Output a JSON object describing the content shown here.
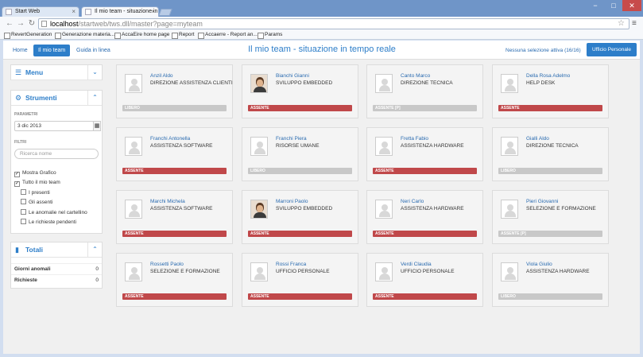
{
  "browser": {
    "tabs": [
      {
        "label": "Start Web",
        "active": false
      },
      {
        "label": "Il mio team - situazione in",
        "active": true
      }
    ],
    "url_host": "localhost",
    "url_path": "/startweb/tws.dll/master?page=myteam",
    "bookmarks": [
      "RevertGeneration",
      "Generazione materia...",
      "AccaEire home page",
      "Report",
      "Accaerre - Report an...",
      "Params"
    ],
    "window_controls": [
      "−",
      "□",
      "✕"
    ]
  },
  "topnav": {
    "links": [
      "Home",
      "Il mio team",
      "Guida in linea"
    ],
    "active_link": "Il mio team",
    "title": "Il mio team - situazione in tempo reale",
    "selection_status": "Nessuna selezione attiva (16/16)",
    "office_button": "Ufficio Personale"
  },
  "sidebar": {
    "menu": {
      "title": "Menu",
      "toggle": "⌄"
    },
    "tools": {
      "title": "Strumenti",
      "toggle": "⌃",
      "params_label": "PARAMETRI",
      "date_value": "3 dic 2013",
      "filters_label": "FILTRI",
      "search_placeholder": "Ricerca nome",
      "checks": [
        {
          "label": "Mostra Grafico",
          "checked": true,
          "indent": 0
        },
        {
          "label": "Tutto il mio team",
          "checked": true,
          "indent": 0
        },
        {
          "label": "I presenti",
          "checked": false,
          "indent": 1
        },
        {
          "label": "Gli assenti",
          "checked": false,
          "indent": 1
        },
        {
          "label": "Le anomalie nel cartellino",
          "checked": false,
          "indent": 1
        },
        {
          "label": "Le richieste pendenti",
          "checked": false,
          "indent": 1
        }
      ]
    },
    "totals": {
      "title": "Totali",
      "toggle": "⌃",
      "rows": [
        {
          "label": "Giorni anomali",
          "value": "0"
        },
        {
          "label": "Richieste",
          "value": "0"
        }
      ]
    }
  },
  "team": [
    {
      "name": "Anzil Aldo",
      "role": "DIREZIONE ASSISTENZA CLIENTI",
      "status": "LIBERO",
      "state": "present",
      "photo": false
    },
    {
      "name": "Bianchi Gianni",
      "role": "SVILUPPO EMBEDDED",
      "status": "ASSENTE",
      "state": "absent",
      "photo": true
    },
    {
      "name": "Canto Marco",
      "role": "DIREZIONE TECNICA",
      "status": "ASSENTE [P]",
      "state": "present",
      "photo": false
    },
    {
      "name": "Della Rosa Adelmo",
      "role": "HELP DESK",
      "status": "ASSENTE",
      "state": "absent",
      "photo": false
    },
    {
      "name": "Franchi Antonella",
      "role": "ASSISTENZA SOFTWARE",
      "status": "ASSENTE",
      "state": "absent",
      "photo": false
    },
    {
      "name": "Franchi Piera",
      "role": "RISORSE UMANE",
      "status": "LIBERO",
      "state": "present",
      "photo": false
    },
    {
      "name": "Fretta Fabio",
      "role": "ASSISTENZA HARDWARE",
      "status": "ASSENTE",
      "state": "absent",
      "photo": false
    },
    {
      "name": "Gialli Aldo",
      "role": "DIREZIONE TECNICA",
      "status": "LIBERO",
      "state": "present",
      "photo": false
    },
    {
      "name": "Marchi Michela",
      "role": "ASSISTENZA SOFTWARE",
      "status": "ASSENTE",
      "state": "absent",
      "photo": false
    },
    {
      "name": "Marroni Paolo",
      "role": "SVILUPPO EMBEDDED",
      "status": "ASSENTE",
      "state": "absent",
      "photo": true
    },
    {
      "name": "Neri Carlo",
      "role": "ASSISTENZA HARDWARE",
      "status": "ASSENTE",
      "state": "absent",
      "photo": false
    },
    {
      "name": "Pieri Giovanni",
      "role": "SELEZIONE E FORMAZIONE",
      "status": "ASSENTE [P]",
      "state": "present",
      "photo": false
    },
    {
      "name": "Rossetti Paolo",
      "role": "SELEZIONE E FORMAZIONE",
      "status": "ASSENTE",
      "state": "absent",
      "photo": false
    },
    {
      "name": "Rossi Franca",
      "role": "UFFICIO PERSONALE",
      "status": "ASSENTE",
      "state": "absent",
      "photo": false
    },
    {
      "name": "Verdi Claudia",
      "role": "UFFICIO PERSONALE",
      "status": "ASSENTE",
      "state": "absent",
      "photo": false
    },
    {
      "name": "Viola Giulio",
      "role": "ASSISTENZA HARDWARE",
      "status": "LIBERO",
      "state": "present",
      "photo": false
    }
  ],
  "colors": {
    "accent": "#2d7ec9",
    "absent": "#c0484a",
    "present": "#c8c8c8"
  },
  "icons": {
    "menu": "bars-icon",
    "tools": "gear-icon",
    "totals": "bar-chart-icon",
    "calendar": "calendar-icon",
    "star": "star-icon"
  }
}
